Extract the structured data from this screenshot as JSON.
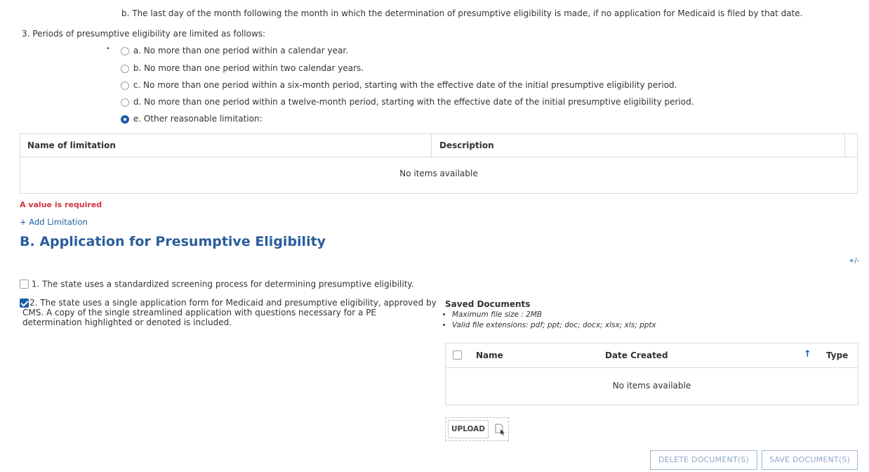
{
  "top_item_b": "b.  The last day of the month following the month in which the determination of presumptive eligibility is made, if no application for Medicaid is filed by that date.",
  "item3": {
    "label": "3.  Periods of presumptive eligibility are limited as follows:",
    "bullet": "•",
    "options": [
      {
        "label": "a. No more than one period within a calendar year.",
        "checked": false
      },
      {
        "label": "b. No more than one period within two calendar years.",
        "checked": false
      },
      {
        "label": "c. No more than one period within a six-month period, starting with the effective date of the initial presumptive eligibility period.",
        "checked": false
      },
      {
        "label": "d. No more than one period within a twelve-month period, starting with the effective date of the initial presumptive eligibility period.",
        "checked": false
      },
      {
        "label": "e. Other reasonable limitation:",
        "checked": true
      }
    ]
  },
  "limitation_grid": {
    "columns": [
      "Name of limitation",
      "Description"
    ],
    "empty_text": "No items available"
  },
  "validation_error": "A value is required",
  "add_limitation_link": "+ Add Limitation",
  "section_b": {
    "title": "B. Application for Presumptive Eligibility",
    "expand_toggle": "+/-",
    "item1": {
      "label": "1. The state uses a standardized screening process for determining presumptive eligibility.",
      "checked": false
    },
    "item2": {
      "lines": [
        "2. The state uses a single application form for Medicaid and presumptive eligibility, approved by",
        "CMS. A copy of the single streamlined application with questions necessary for a PE",
        "determination highlighted or denoted is included."
      ],
      "checked": true
    }
  },
  "documents": {
    "title": "Saved Documents",
    "max_size": "Maximum file size : 2MB",
    "extensions": "Valid file extensions: pdf; ppt; doc; docx; xlsx; xls; pptx",
    "columns": [
      "Name",
      "Date Created",
      "Type"
    ],
    "sort_icon": "arrow-up-icon",
    "empty_text": "No items available",
    "upload_label": "UPLOAD",
    "delete_label": "DELETE DOCUMENT(S)",
    "save_label": "SAVE DOCUMENT(S)"
  },
  "colors": {
    "accent": "#1f5ea8",
    "error": "#d0343f",
    "heading": "#2a5d9b"
  }
}
